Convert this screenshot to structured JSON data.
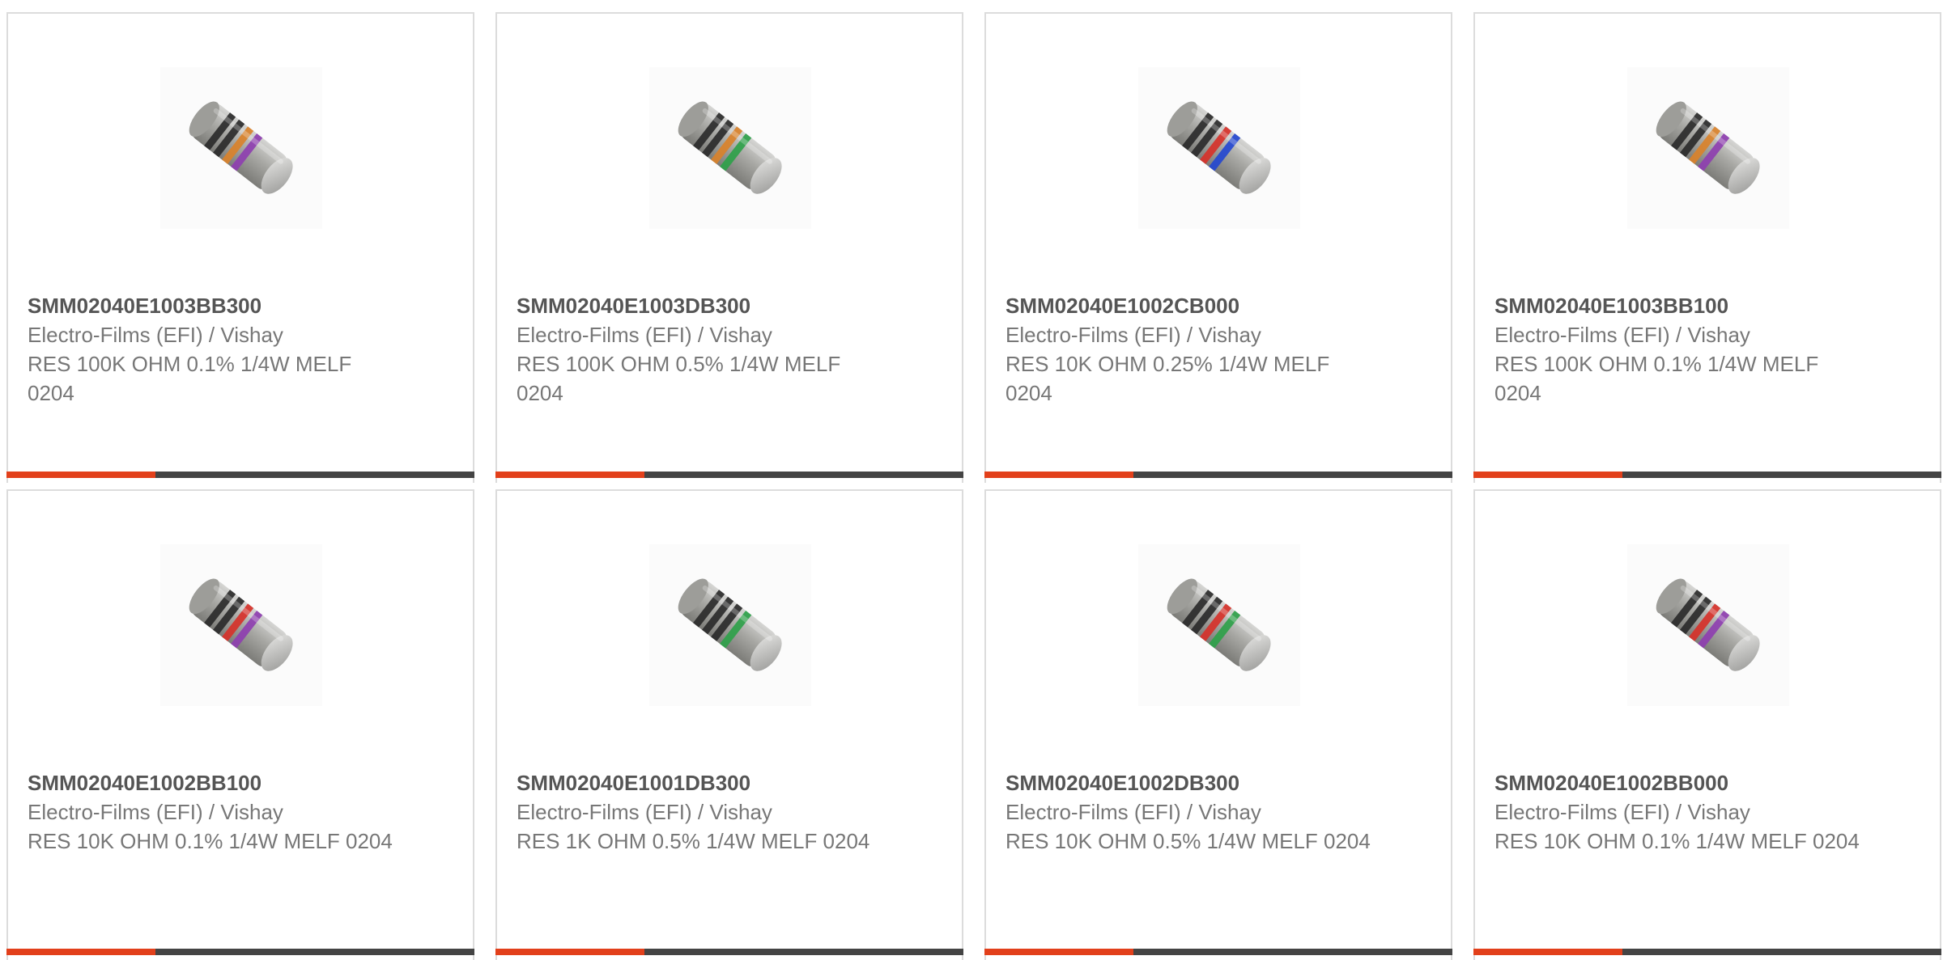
{
  "colors": {
    "accent": "#e2401b",
    "bar_dark": "#444444",
    "text_bold": "#555555",
    "text_regular": "#777777"
  },
  "products": [
    {
      "part_number": "SMM02040E1003BB300",
      "manufacturer": "Electro-Films (EFI) / Vishay",
      "description": "RES 100K OHM 0.1% 1/4W MELF 0204",
      "bands": [
        "#2b2b2b",
        "#2b2b2b",
        "#d9822b",
        "#8e3fb0"
      ]
    },
    {
      "part_number": "SMM02040E1003DB300",
      "manufacturer": "Electro-Films (EFI) / Vishay",
      "description": "RES 100K OHM 0.5% 1/4W MELF 0204",
      "bands": [
        "#2b2b2b",
        "#2b2b2b",
        "#d9822b",
        "#2fa14a"
      ]
    },
    {
      "part_number": "SMM02040E1002CB000",
      "manufacturer": "Electro-Films (EFI) / Vishay",
      "description": "RES 10K OHM 0.25% 1/4W MELF 0204",
      "bands": [
        "#2b2b2b",
        "#2b2b2b",
        "#d6322a",
        "#2548d0"
      ]
    },
    {
      "part_number": "SMM02040E1003BB100",
      "manufacturer": "Electro-Films (EFI) / Vishay",
      "description": "RES 100K OHM 0.1% 1/4W MELF 0204",
      "bands": [
        "#2b2b2b",
        "#2b2b2b",
        "#d9822b",
        "#8e3fb0"
      ]
    },
    {
      "part_number": "SMM02040E1002BB100",
      "manufacturer": "Electro-Films (EFI) / Vishay",
      "description": "RES 10K OHM 0.1% 1/4W MELF 0204",
      "bands": [
        "#2b2b2b",
        "#2b2b2b",
        "#d6322a",
        "#8e3fb0"
      ]
    },
    {
      "part_number": "SMM02040E1001DB300",
      "manufacturer": "Electro-Films (EFI) / Vishay",
      "description": "RES 1K OHM 0.5% 1/4W MELF 0204",
      "bands": [
        "#2b2b2b",
        "#2b2b2b",
        "#2b2b2b",
        "#2fa14a"
      ]
    },
    {
      "part_number": "SMM02040E1002DB300",
      "manufacturer": "Electro-Films (EFI) / Vishay",
      "description": "RES 10K OHM 0.5% 1/4W MELF 0204",
      "bands": [
        "#2b2b2b",
        "#2b2b2b",
        "#d6322a",
        "#2fa14a"
      ]
    },
    {
      "part_number": "SMM02040E1002BB000",
      "manufacturer": "Electro-Films (EFI) / Vishay",
      "description": "RES 10K OHM 0.1% 1/4W MELF 0204",
      "bands": [
        "#2b2b2b",
        "#2b2b2b",
        "#d6322a",
        "#8e3fb0"
      ]
    }
  ]
}
